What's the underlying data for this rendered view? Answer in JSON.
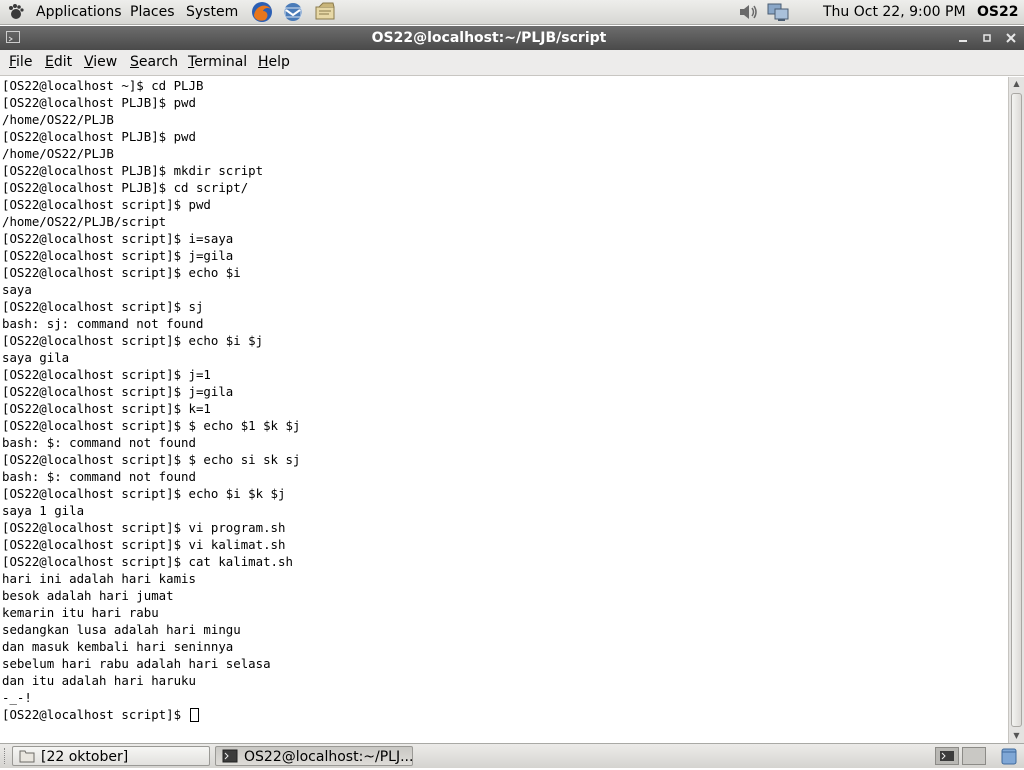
{
  "top_panel": {
    "menus": [
      "Applications",
      "Places",
      "System"
    ],
    "launchers": [
      "firefox-icon",
      "evolution-mail-icon",
      "notes-icon"
    ],
    "clock": "Thu Oct 22,  9:00 PM",
    "user": "OS22",
    "tray_icons": [
      "volume-icon",
      "network-icon"
    ]
  },
  "window": {
    "title": "OS22@localhost:~/PLJB/script",
    "buttons": [
      "minimize",
      "maximize",
      "close"
    ]
  },
  "menubar": {
    "items": [
      {
        "label": "File",
        "mnemonic": "F",
        "rest": "ile"
      },
      {
        "label": "Edit",
        "mnemonic": "E",
        "rest": "dit"
      },
      {
        "label": "View",
        "mnemonic": "V",
        "rest": "iew"
      },
      {
        "label": "Search",
        "mnemonic": "S",
        "rest": "earch"
      },
      {
        "label": "Terminal",
        "mnemonic": "T",
        "rest": "erminal"
      },
      {
        "label": "Help",
        "mnemonic": "H",
        "rest": "elp"
      }
    ]
  },
  "terminal": {
    "lines": [
      "[OS22@localhost ~]$ cd PLJB",
      "[OS22@localhost PLJB]$ pwd",
      "/home/OS22/PLJB",
      "[OS22@localhost PLJB]$ pwd",
      "/home/OS22/PLJB",
      "[OS22@localhost PLJB]$ mkdir script",
      "[OS22@localhost PLJB]$ cd script/",
      "[OS22@localhost script]$ pwd",
      "/home/OS22/PLJB/script",
      "[OS22@localhost script]$ i=saya",
      "[OS22@localhost script]$ j=gila",
      "[OS22@localhost script]$ echo $i",
      "saya",
      "[OS22@localhost script]$ sj",
      "bash: sj: command not found",
      "[OS22@localhost script]$ echo $i $j",
      "saya gila",
      "[OS22@localhost script]$ j=1",
      "[OS22@localhost script]$ j=gila",
      "[OS22@localhost script]$ k=1",
      "[OS22@localhost script]$ $ echo $1 $k $j",
      "bash: $: command not found",
      "[OS22@localhost script]$ $ echo si sk sj",
      "bash: $: command not found",
      "[OS22@localhost script]$ echo $i $k $j",
      "saya 1 gila",
      "[OS22@localhost script]$ vi program.sh",
      "[OS22@localhost script]$ vi kalimat.sh",
      "[OS22@localhost script]$ cat kalimat.sh",
      "hari ini adalah hari kamis",
      "besok adalah hari jumat",
      "kemarin itu hari rabu",
      "sedangkan lusa adalah hari mingu",
      "dan masuk kembali hari seninnya",
      "sebelum hari rabu adalah hari selasa",
      "dan itu adalah hari haruku",
      "-_-!"
    ],
    "prompt": "[OS22@localhost script]$ "
  },
  "taskbar": {
    "items": [
      {
        "label": "[22 oktober]",
        "icon": "folder-icon",
        "active": false
      },
      {
        "label": "OS22@localhost:~/PLJ...",
        "icon": "terminal-icon",
        "active": true
      }
    ],
    "tray": [
      "show-terminal-icon",
      "workspace-icon",
      "trash-icon"
    ]
  },
  "colors": {
    "titlebar": "#4a4a4a",
    "terminal_bg": "#ffffff",
    "terminal_fg": "#000000",
    "panel": "#e2e1de"
  }
}
